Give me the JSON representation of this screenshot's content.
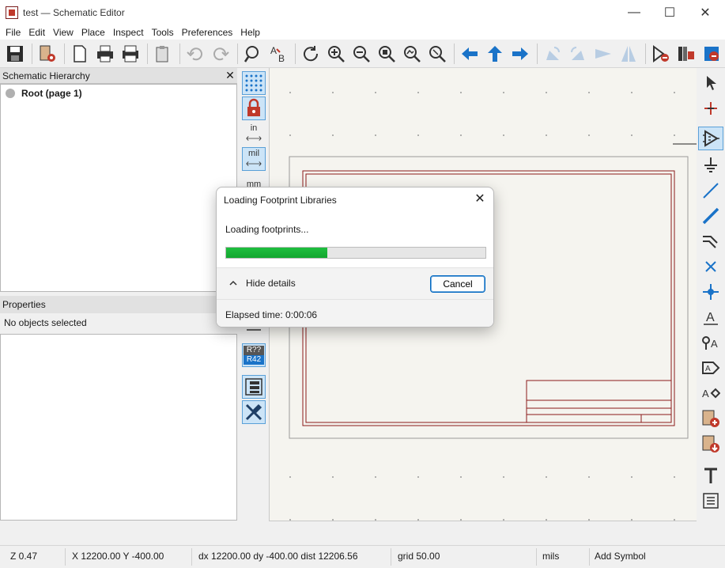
{
  "window": {
    "title": "test — Schematic Editor",
    "controls": {
      "minimize": "—",
      "maximize": "☐",
      "close": "✕"
    }
  },
  "menu": [
    "File",
    "Edit",
    "View",
    "Place",
    "Inspect",
    "Tools",
    "Preferences",
    "Help"
  ],
  "toolbar_icons": [
    "save-icon",
    "schematic-setup-icon",
    "page-settings-icon",
    "print-icon",
    "plot-icon",
    "paste-icon",
    "undo-icon",
    "redo-icon",
    "find-icon",
    "find-replace-icon",
    "refresh-icon",
    "zoom-in-icon",
    "zoom-out-icon",
    "zoom-fit-icon",
    "zoom-objects-icon",
    "zoom-selection-icon",
    "navigate-back-icon",
    "navigate-up-icon",
    "navigate-forward-icon",
    "rotate-ccw-icon",
    "rotate-cw-icon",
    "mirror-vertical-icon",
    "mirror-horizontal-icon",
    "erc-icon",
    "symbol-library-icon",
    "footprint-assign-icon"
  ],
  "hierarchy": {
    "title": "Schematic Hierarchy",
    "close": "✕",
    "root": "Root (page 1)"
  },
  "properties": {
    "title": "Properties",
    "status": "No objects selected"
  },
  "left_toolbar": {
    "units": {
      "inches": "in",
      "mils": "mil",
      "millimeters": "mm"
    },
    "annotate_top": "R??",
    "annotate_bottom": "R42"
  },
  "status": {
    "zoom": "Z 0.47",
    "xy": "X 12200.00  Y -400.00",
    "delta": "dx 12200.00  dy -400.00  dist 12206.56",
    "grid": "grid 50.00",
    "units": "mils",
    "mode": "Add Symbol"
  },
  "dialog": {
    "title": "Loading Footprint Libraries",
    "close": "✕",
    "message": "Loading footprints...",
    "progress": 0.39,
    "details_label": "Hide details",
    "cancel": "Cancel",
    "elapsed": "Elapsed time: 0:00:06"
  },
  "colors": {
    "accent": "#0067c0",
    "progress": "#13a62f",
    "sheet_border": "#8b1a1a",
    "canvas": "#f5f4ef",
    "tool_blue": "#1a73c8"
  }
}
